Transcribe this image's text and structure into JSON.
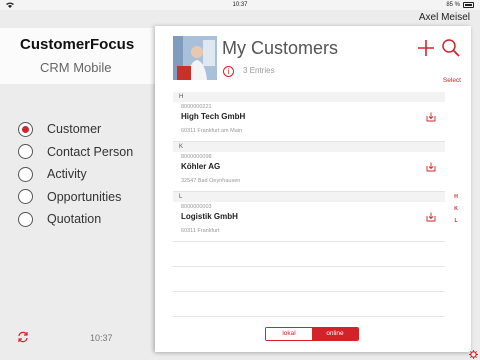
{
  "status_bar": {
    "time": "10:37",
    "battery": "85 %"
  },
  "header": {
    "user_name": "Axel Meisel"
  },
  "app": {
    "title": "CustomerFocus",
    "subtitle": "CRM Mobile"
  },
  "nav": {
    "items": [
      {
        "label": "Customer",
        "selected": true
      },
      {
        "label": "Contact Person",
        "selected": false
      },
      {
        "label": "Activity",
        "selected": false
      },
      {
        "label": "Opportunities",
        "selected": false
      },
      {
        "label": "Quotation",
        "selected": false
      }
    ]
  },
  "footer": {
    "time": "10:37"
  },
  "panel": {
    "title": "My Customers",
    "entries_text": "3 Entries",
    "select_label": "Select",
    "sections": [
      {
        "letter": "H",
        "customer": {
          "id": "8000000221",
          "name": "High Tech GmbH",
          "address": "60311 Frankfurt am Main"
        }
      },
      {
        "letter": "K",
        "customer": {
          "id": "8000000098",
          "name": "Köhler AG",
          "address": "32547 Bad Oeynhausen"
        }
      },
      {
        "letter": "L",
        "customer": {
          "id": "8000000003",
          "name": "Logistik GmbH",
          "address": "60311 Frankfurt"
        }
      }
    ],
    "index_letters": [
      "H",
      "K",
      "L"
    ],
    "toggle": {
      "left_label": "lokal",
      "right_label": "online",
      "active": "online"
    }
  },
  "colors": {
    "accent": "#d2232a",
    "background": "#ececec",
    "panel": "#ffffff"
  },
  "icons": [
    "wifi-icon",
    "battery-icon",
    "sync-icon",
    "info-icon",
    "plus-icon",
    "search-icon",
    "download-icon",
    "gear-icon"
  ]
}
